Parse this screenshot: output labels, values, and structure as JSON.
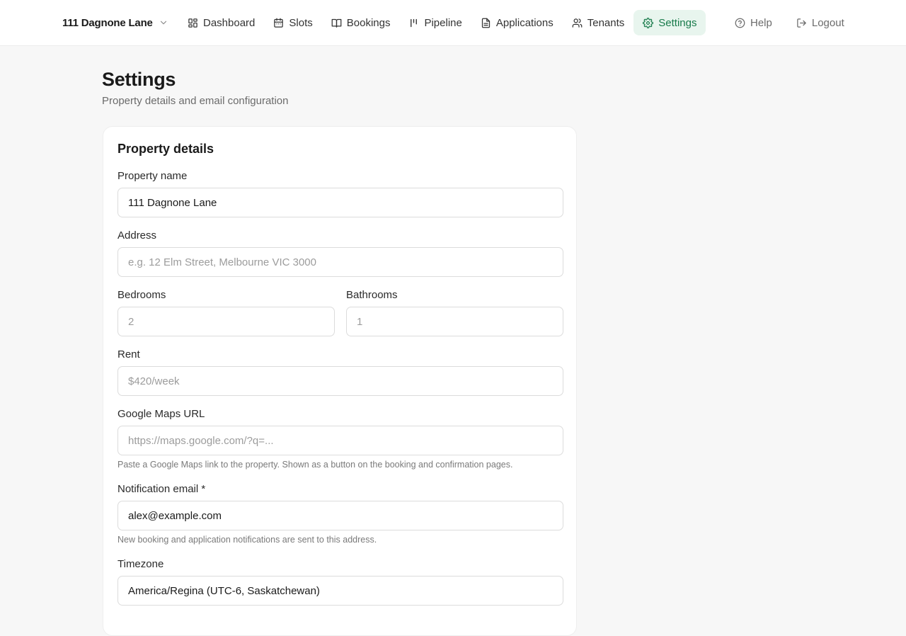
{
  "header": {
    "property_name": "111 Dagnone Lane",
    "nav": [
      {
        "label": "Dashboard",
        "icon": "dashboard-icon"
      },
      {
        "label": "Slots",
        "icon": "calendar-icon"
      },
      {
        "label": "Bookings",
        "icon": "book-icon"
      },
      {
        "label": "Pipeline",
        "icon": "pipeline-icon"
      },
      {
        "label": "Applications",
        "icon": "document-icon"
      },
      {
        "label": "Tenants",
        "icon": "users-icon"
      },
      {
        "label": "Settings",
        "icon": "gear-icon",
        "active": true
      }
    ],
    "secondary_nav": [
      {
        "label": "Help",
        "icon": "help-icon"
      },
      {
        "label": "Logout",
        "icon": "logout-icon"
      }
    ]
  },
  "page": {
    "title": "Settings",
    "subtitle": "Property details and email configuration"
  },
  "property_card": {
    "title": "Property details",
    "property_name": {
      "label": "Property name",
      "value": "111 Dagnone Lane",
      "placeholder": ""
    },
    "address": {
      "label": "Address",
      "value": "",
      "placeholder": "e.g. 12 Elm Street, Melbourne VIC 3000"
    },
    "bedrooms": {
      "label": "Bedrooms",
      "value": "",
      "placeholder": "2"
    },
    "bathrooms": {
      "label": "Bathrooms",
      "value": "",
      "placeholder": "1"
    },
    "rent": {
      "label": "Rent",
      "value": "",
      "placeholder": "$420/week"
    },
    "maps_url": {
      "label": "Google Maps URL",
      "value": "",
      "placeholder": "https://maps.google.com/?q=...",
      "hint": "Paste a Google Maps link to the property. Shown as a button on the booking and confirmation pages."
    },
    "notification_email": {
      "label": "Notification email *",
      "value": "alex@example.com",
      "placeholder": "",
      "hint": "New booking and application notifications are sent to this address."
    },
    "timezone": {
      "label": "Timezone",
      "value": "America/Regina (UTC-6, Saskatchewan)",
      "placeholder": ""
    }
  },
  "colors": {
    "accent": "#177a4a",
    "accent_bg": "#e8f5ee",
    "page_bg": "#f7f7f7"
  }
}
